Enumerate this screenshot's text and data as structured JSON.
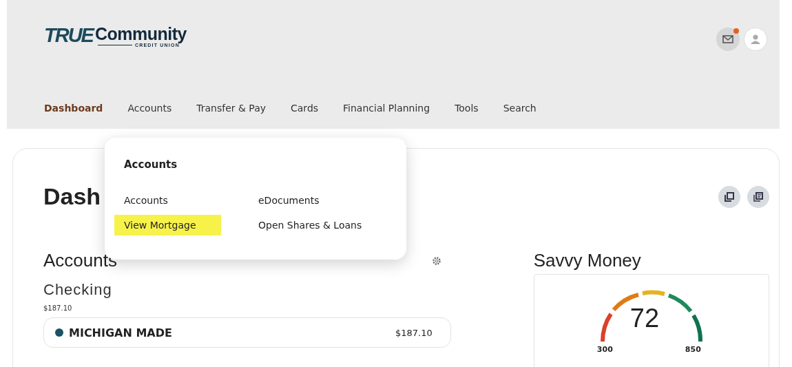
{
  "header": {
    "logo_mark": "TRUE",
    "logo_name": "Community",
    "logo_sub": "CREDIT UNION",
    "has_unread_mail": true
  },
  "nav": [
    {
      "label": "Dashboard",
      "selected": true
    },
    {
      "label": "Accounts",
      "selected": false
    },
    {
      "label": "Transfer & Pay",
      "selected": false
    },
    {
      "label": "Cards",
      "selected": false
    },
    {
      "label": "Financial Planning",
      "selected": false
    },
    {
      "label": "Tools",
      "selected": false
    },
    {
      "label": "Search",
      "selected": false
    }
  ],
  "dropdown": {
    "title": "Accounts",
    "items": [
      {
        "label": "Accounts",
        "highlighted": false
      },
      {
        "label": "eDocuments",
        "highlighted": false
      },
      {
        "label": "View Mortgage",
        "highlighted": true
      },
      {
        "label": "Open Shares & Loans",
        "highlighted": false
      }
    ]
  },
  "page": {
    "title": "Dash"
  },
  "accounts": {
    "title": "Accounts",
    "group": "Checking",
    "group_total": "$187.10",
    "account_name": "MICHIGAN MADE",
    "account_balance": "$187.10"
  },
  "savvy": {
    "title": "Savvy Money",
    "score": "72",
    "min": "300",
    "max": "850"
  }
}
